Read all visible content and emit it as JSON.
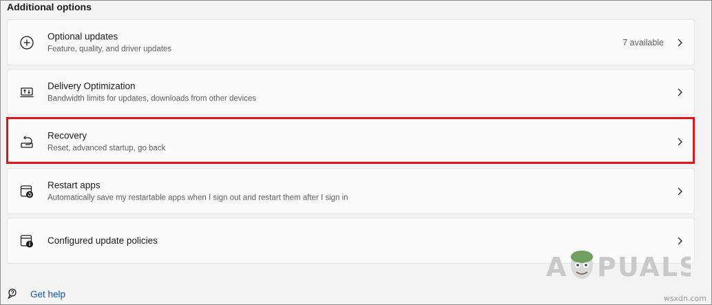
{
  "section": {
    "title": "Additional options"
  },
  "cards": [
    {
      "title": "Optional updates",
      "subtitle": "Feature, quality, and driver updates",
      "badge": "7 available",
      "icon": "plus-circle-icon"
    },
    {
      "title": "Delivery Optimization",
      "subtitle": "Bandwidth limits for updates, downloads from other devices",
      "icon": "delivery-optimization-icon"
    },
    {
      "title": "Recovery",
      "subtitle": "Reset, advanced startup, go back",
      "icon": "recovery-icon"
    },
    {
      "title": "Restart apps",
      "subtitle": "Automatically save my restartable apps when I sign out and restart them after I sign in",
      "icon": "restart-apps-icon"
    },
    {
      "title": "Configured update policies",
      "icon": "update-policies-icon"
    }
  ],
  "footer": {
    "get_help": "Get help",
    "icon": "get-help-icon"
  },
  "watermark": {
    "brand": "APPUALS",
    "site": "wsxdn.com"
  },
  "colors": {
    "highlight": "#e0141e",
    "link": "#0f5aa8"
  }
}
